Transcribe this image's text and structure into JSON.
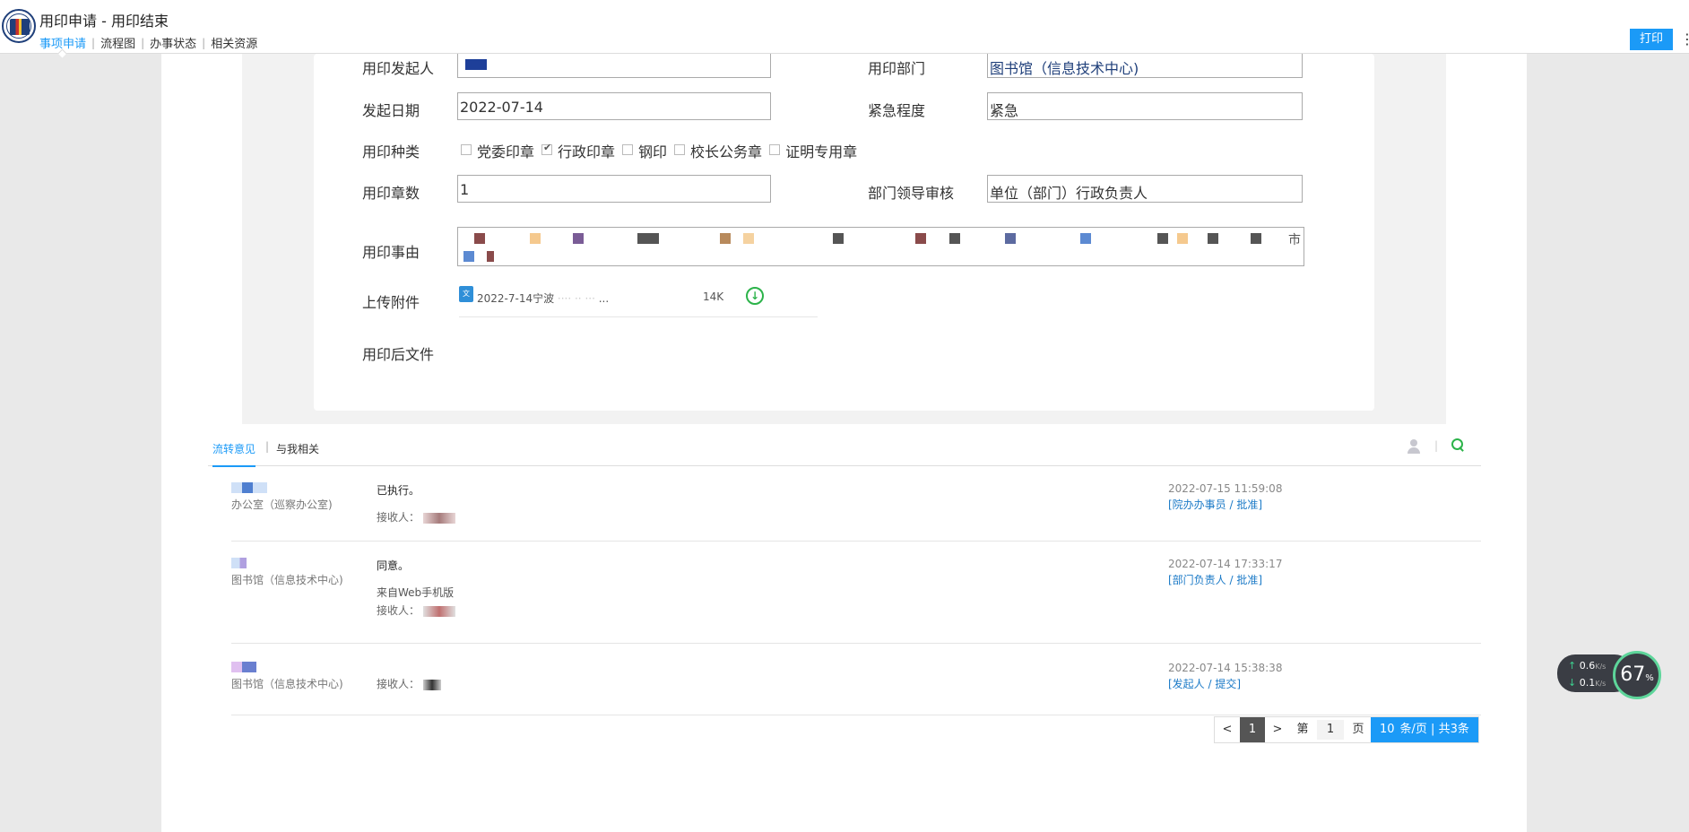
{
  "header": {
    "title": "用印申请 - 用印结束",
    "nav": [
      "事项申请",
      "流程图",
      "办事状态",
      "相关资源"
    ],
    "print_label": "打印",
    "more": "⋮"
  },
  "form": {
    "initiator_label": "用印发起人",
    "dept_label": "用印部门",
    "dept_value": "图书馆（信息技术中心)",
    "date_label": "发起日期",
    "date_value": "2022-07-14",
    "urgency_label": "紧急程度",
    "urgency_value": "紧急",
    "seal_type_label": "用印种类",
    "seal_types": [
      {
        "label": "党委印章",
        "checked": false
      },
      {
        "label": "行政印章",
        "checked": true
      },
      {
        "label": "钢印",
        "checked": false
      },
      {
        "label": "校长公务章",
        "checked": false
      },
      {
        "label": "证明专用章",
        "checked": false
      }
    ],
    "count_label": "用印章数",
    "count_value": "1",
    "leader_label": "部门领导审核",
    "leader_value": "单位（部门）行政负责人",
    "reason_label": "用印事由",
    "reason_tail": "市",
    "attach_label": "上传附件",
    "attach_icon": "file-icon",
    "attach_name": "2022-7-14宁波",
    "attach_ellipsis": "...",
    "attach_size": "14K",
    "after_label": "用印后文件"
  },
  "tabs": {
    "items": [
      "流转意见",
      "与我相关"
    ]
  },
  "comments": [
    {
      "dept": "办公室（巡察办公室)",
      "text": "已执行。",
      "sub": "",
      "recv_label": "接收人：",
      "time": "2022-07-15   11:59:08",
      "role": "[院办办事员 / 批准]"
    },
    {
      "dept": "图书馆（信息技术中心)",
      "text": "同意。",
      "sub": "来自Web手机版",
      "recv_label": "接收人：",
      "time": "2022-07-14   17:33:17",
      "role": "[部门负责人 / 批准]"
    },
    {
      "dept": "图书馆（信息技术中心)",
      "text": "",
      "sub": "",
      "recv_label": "接收人：",
      "time": "2022-07-14   15:38:38",
      "role": "[发起人 / 提交]"
    }
  ],
  "pager": {
    "prev": "<",
    "current": "1",
    "next": ">",
    "page_prefix": "第",
    "page_input": "1",
    "page_suffix": "页",
    "per_page": "10",
    "summary": "条/页 | 共3条"
  },
  "net_widget": {
    "up": "0.6",
    "down": "0.1",
    "unit": "K/s",
    "percent": "67",
    "percent_sign": "%"
  },
  "colors": {
    "accent": "#1b9af7",
    "green": "#2cb34a",
    "link": "#1f3f7a"
  }
}
